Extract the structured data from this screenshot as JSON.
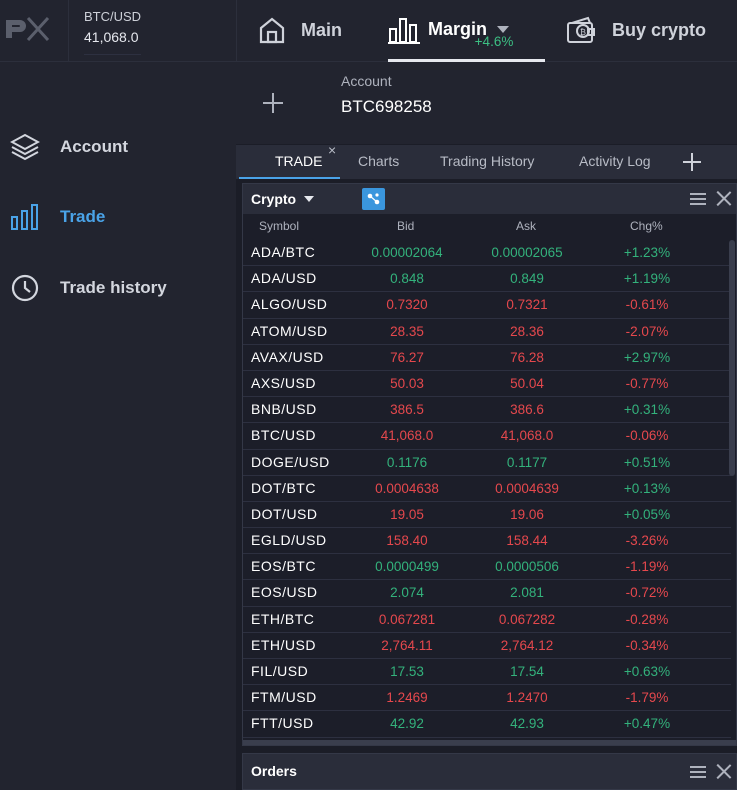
{
  "ticker": {
    "symbol": "BTC/USD",
    "price": "41,068.0",
    "change": "+4.6%"
  },
  "nav": {
    "main": "Main",
    "margin": "Margin",
    "buy": "Buy crypto"
  },
  "sidebar": {
    "items": [
      {
        "label": "Account",
        "icon": "layers-icon"
      },
      {
        "label": "Trade",
        "icon": "bar-chart-icon"
      },
      {
        "label": "Trade history",
        "icon": "clock-icon"
      }
    ]
  },
  "account": {
    "label": "Account",
    "value": "BTC698258"
  },
  "tabs": {
    "trade": "TRADE",
    "charts": "Charts",
    "history": "Trading History",
    "log": "Activity Log"
  },
  "panel": {
    "title": "Crypto",
    "columns": {
      "symbol": "Symbol",
      "bid": "Bid",
      "ask": "Ask",
      "chg": "Chg%"
    }
  },
  "rows": [
    {
      "symbol": "ADA/BTC",
      "bid": "0.00002064",
      "ask": "0.00002065",
      "chg": "+1.23%",
      "dir": "up"
    },
    {
      "symbol": "ADA/USD",
      "bid": "0.848",
      "ask": "0.849",
      "chg": "+1.19%",
      "dir": "up"
    },
    {
      "symbol": "ALGO/USD",
      "bid": "0.7320",
      "ask": "0.7321",
      "chg": "-0.61%",
      "dir": "down"
    },
    {
      "symbol": "ATOM/USD",
      "bid": "28.35",
      "ask": "28.36",
      "chg": "-2.07%",
      "dir": "down"
    },
    {
      "symbol": "AVAX/USD",
      "bid": "76.27",
      "ask": "76.28",
      "chg": "+2.97%",
      "dir": "down"
    },
    {
      "symbol": "AXS/USD",
      "bid": "50.03",
      "ask": "50.04",
      "chg": "-0.77%",
      "dir": "down"
    },
    {
      "symbol": "BNB/USD",
      "bid": "386.5",
      "ask": "386.6",
      "chg": "+0.31%",
      "dir": "down"
    },
    {
      "symbol": "BTC/USD",
      "bid": "41,068.0",
      "ask": "41,068.0",
      "chg": "-0.06%",
      "dir": "down"
    },
    {
      "symbol": "DOGE/USD",
      "bid": "0.1176",
      "ask": "0.1177",
      "chg": "+0.51%",
      "dir": "up"
    },
    {
      "symbol": "DOT/BTC",
      "bid": "0.0004638",
      "ask": "0.0004639",
      "chg": "+0.13%",
      "dir": "down"
    },
    {
      "symbol": "DOT/USD",
      "bid": "19.05",
      "ask": "19.06",
      "chg": "+0.05%",
      "dir": "down"
    },
    {
      "symbol": "EGLD/USD",
      "bid": "158.40",
      "ask": "158.44",
      "chg": "-3.26%",
      "dir": "down"
    },
    {
      "symbol": "EOS/BTC",
      "bid": "0.0000499",
      "ask": "0.0000506",
      "chg": "-1.19%",
      "dir": "up"
    },
    {
      "symbol": "EOS/USD",
      "bid": "2.074",
      "ask": "2.081",
      "chg": "-0.72%",
      "dir": "up"
    },
    {
      "symbol": "ETH/BTC",
      "bid": "0.067281",
      "ask": "0.067282",
      "chg": "-0.28%",
      "dir": "down"
    },
    {
      "symbol": "ETH/USD",
      "bid": "2,764.11",
      "ask": "2,764.12",
      "chg": "-0.34%",
      "dir": "down"
    },
    {
      "symbol": "FIL/USD",
      "bid": "17.53",
      "ask": "17.54",
      "chg": "+0.63%",
      "dir": "up"
    },
    {
      "symbol": "FTM/USD",
      "bid": "1.2469",
      "ask": "1.2470",
      "chg": "-1.79%",
      "dir": "down"
    },
    {
      "symbol": "FTT/USD",
      "bid": "42.92",
      "ask": "42.93",
      "chg": "+0.47%",
      "dir": "up"
    }
  ],
  "orders": {
    "title": "Orders"
  },
  "colors": {
    "up": "#33b27c",
    "down": "#e5484d",
    "accent": "#4aa3e8"
  }
}
